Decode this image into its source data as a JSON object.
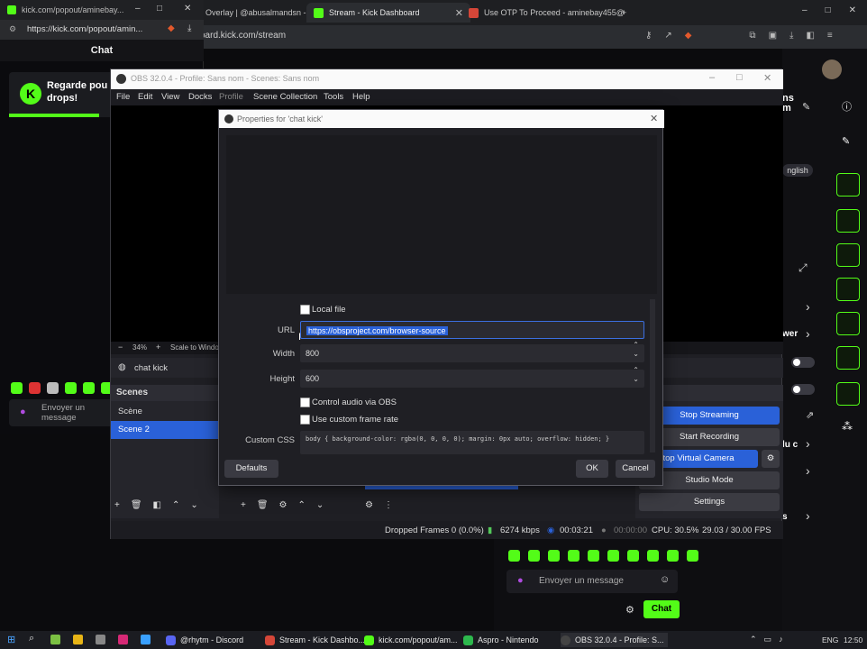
{
  "browser": {
    "tabs": [
      {
        "label": "Overlay | @abusalmandsn -",
        "color": "#6a6a6a"
      },
      {
        "label": "Stream - Kick Dashboard",
        "color": "#53fc18"
      },
      {
        "label": "Use OTP To Proceed - aminebay455@",
        "color": "#d44638"
      }
    ],
    "new_tab": "+",
    "address": "oard.kick.com/stream",
    "window_controls": [
      "–",
      "□",
      "✕"
    ]
  },
  "popout": {
    "url": "https://kick.com/popout/amin...",
    "header_url": "kick.com/popout/aminebay...",
    "chat_title": "Chat",
    "drops_text": "Regarde pou drops!",
    "input_placeholder": "Envoyer un message"
  },
  "right_dash": {
    "lang_badge": "nglish",
    "partial_labels": [
      "ns",
      "m",
      "wer",
      "lu c",
      "s"
    ]
  },
  "kick_chat": {
    "input_placeholder": "Envoyer un message",
    "send_label": "Chat"
  },
  "obs": {
    "title": "OBS 32.0.4 - Profile: Sans nom - Scenes: Sans nom",
    "menu": [
      "File",
      "Edit",
      "View",
      "Docks",
      "Profile",
      "Scene Collection",
      "Tools",
      "Help"
    ],
    "zoom": "34%",
    "scale_label": "Scale to Window",
    "selected_source": "chat kick",
    "scenes_title": "Scenes",
    "scenes": [
      "Scène",
      "Scene 2"
    ],
    "controls_title": "ls",
    "controls": {
      "stop_streaming": "Stop Streaming",
      "start_recording": "Start Recording",
      "stop_virtual_camera": "top Virtual Camera",
      "studio_mode": "Studio Mode",
      "settings": "Settings"
    },
    "status": {
      "dropped_frames": "Dropped Frames 0 (0.0%)",
      "bitrate": "6274 kbps",
      "stream_time": "00:03:21",
      "rec_time": "00:00:00",
      "cpu": "CPU: 30.5%",
      "fps": "29.03 / 30.00 FPS"
    }
  },
  "dialog": {
    "title": "Properties for 'chat kick'",
    "local_file_label": "Local file",
    "url_label": "URL",
    "url_value": "https://obsproject.com/browser-source",
    "width_label": "Width",
    "width_value": "800",
    "height_label": "Height",
    "height_value": "600",
    "control_audio_label": "Control audio via OBS",
    "custom_fps_label": "Use custom frame rate",
    "css_label": "Custom CSS",
    "css_value": "body { background-color: rgba(0, 0, 0, 0); margin: 0px auto; overflow: hidden; }",
    "defaults_label": "Defaults",
    "ok_label": "OK",
    "cancel_label": "Cancel"
  },
  "taskbar": {
    "apps": [
      {
        "label": "@rhytm - Discord",
        "color": "#5865f2"
      },
      {
        "label": "Stream - Kick Dashbo...",
        "color": "#d44638"
      },
      {
        "label": "kick.com/popout/am...",
        "color": "#53fc18"
      },
      {
        "label": "Aspro - Nintendo",
        "color": "#2db84d"
      },
      {
        "label": "OBS 32.0.4 - Profile: S...",
        "color": "#444"
      }
    ],
    "lang": "ENG",
    "time": "12:50"
  }
}
